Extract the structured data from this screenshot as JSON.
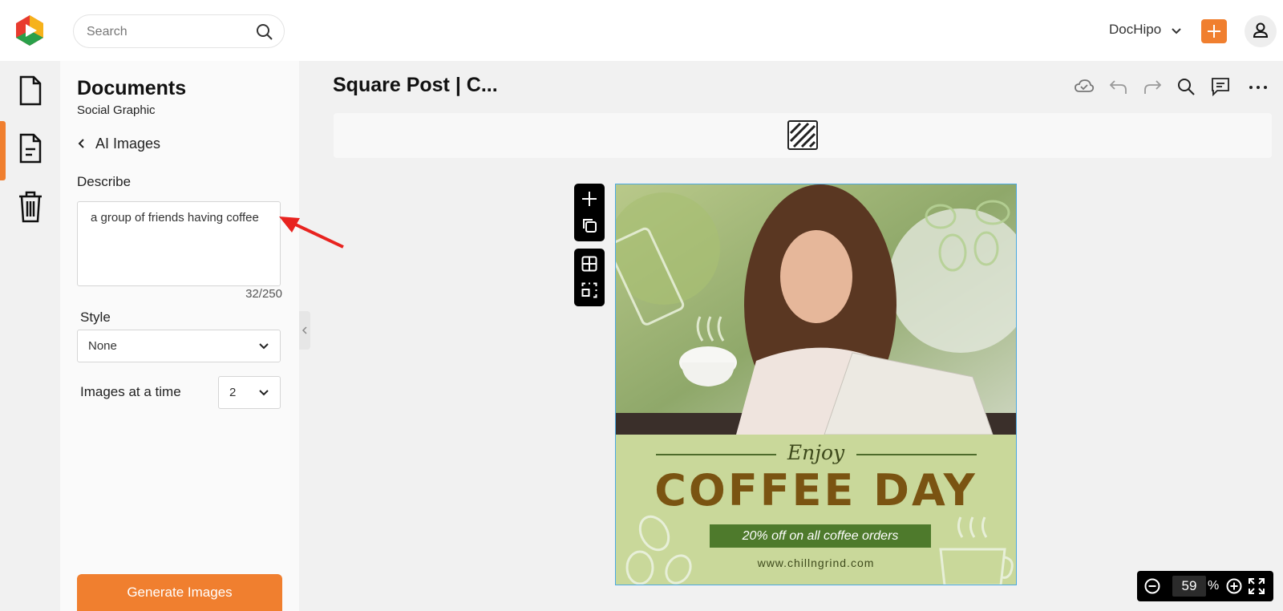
{
  "header": {
    "search_placeholder": "Search",
    "account_name": "DocHipo",
    "accent_color": "#f07f2f"
  },
  "rail": {
    "items": [
      {
        "icon": "document-icon",
        "active": false
      },
      {
        "icon": "document-lines-icon",
        "active": true
      },
      {
        "icon": "trash-icon",
        "active": false
      }
    ]
  },
  "panel": {
    "title": "Documents",
    "subtitle": "Social Graphic",
    "back_label": "AI Images",
    "describe_label": "Describe",
    "describe_value": "a group of friends having coffee",
    "char_counter": "32/250",
    "style_label": "Style",
    "style_value": "None",
    "images_label": "Images at a time",
    "images_value": "2",
    "generate_label": "Generate Images"
  },
  "editor": {
    "doc_title": "Square Post | C...",
    "zoom_value": "59",
    "zoom_unit": "%"
  },
  "design": {
    "enjoy": "Enjoy",
    "headline": "COFFEE DAY",
    "promo": "20% off on all coffee orders",
    "url": "www.chillngrind.com",
    "background_color": "#c9d89a",
    "headline_color": "#7a5412",
    "promo_color": "#4e7a2c"
  }
}
